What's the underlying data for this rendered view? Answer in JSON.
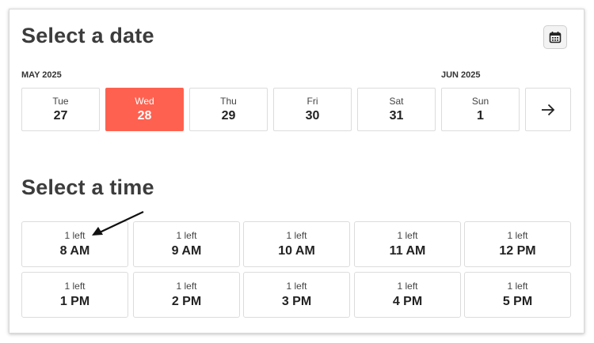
{
  "header": {
    "date_title": "Select a date",
    "calendar_icon": "calendar-icon"
  },
  "months": {
    "first": "MAY 2025",
    "second": "JUN 2025"
  },
  "days": [
    {
      "dow": "Tue",
      "num": "27",
      "selected": false
    },
    {
      "dow": "Wed",
      "num": "28",
      "selected": true
    },
    {
      "dow": "Thu",
      "num": "29",
      "selected": false
    },
    {
      "dow": "Fri",
      "num": "30",
      "selected": false
    },
    {
      "dow": "Sat",
      "num": "31",
      "selected": false
    },
    {
      "dow": "Sun",
      "num": "1",
      "selected": false
    }
  ],
  "next_icon": "arrow-right-icon",
  "time_section": {
    "title": "Select a time"
  },
  "slots": [
    {
      "left": "1 left",
      "time": "8 AM"
    },
    {
      "left": "1 left",
      "time": "9 AM"
    },
    {
      "left": "1 left",
      "time": "10 AM"
    },
    {
      "left": "1 left",
      "time": "11 AM"
    },
    {
      "left": "1 left",
      "time": "12 PM"
    },
    {
      "left": "1 left",
      "time": "1 PM"
    },
    {
      "left": "1 left",
      "time": "2 PM"
    },
    {
      "left": "1 left",
      "time": "3 PM"
    },
    {
      "left": "1 left",
      "time": "4 PM"
    },
    {
      "left": "1 left",
      "time": "5 PM"
    }
  ],
  "colors": {
    "accent": "#ff6150",
    "heading": "#3c3c3c",
    "border": "#dcdcdc"
  }
}
